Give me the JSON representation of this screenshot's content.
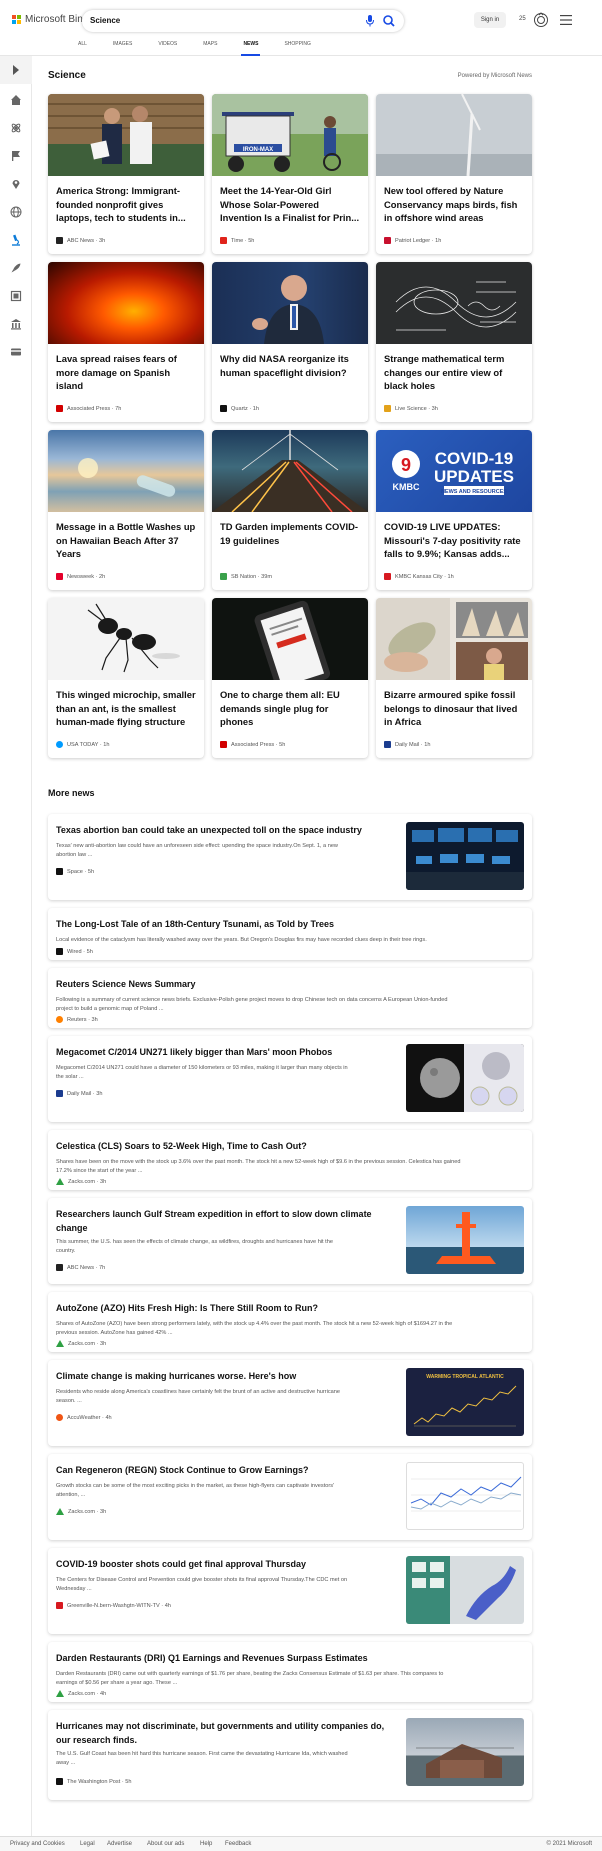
{
  "header": {
    "logo_text": "Microsoft Bing",
    "query": "Science",
    "sign_in": "Sign in",
    "points": "25"
  },
  "tabs": [
    "ALL",
    "IMAGES",
    "VIDEOS",
    "MAPS",
    "NEWS",
    "SHOPPING"
  ],
  "section": {
    "title": "Science",
    "powered": "Powered by Microsoft News"
  },
  "cards": [
    {
      "title": "America Strong: Immigrant-founded nonprofit gives laptops, tech to students in...",
      "source": "ABC News · 3h",
      "icon_color": "#222"
    },
    {
      "title": "Meet the 14-Year-Old Girl Whose Solar-Powered Invention Is a Finalist for Prin...",
      "source": "Time · 5h",
      "icon_color": "#e0241b"
    },
    {
      "title": "New tool offered by Nature Conservancy maps birds, fish in offshore wind areas",
      "source": "Patriot Ledger · 1h",
      "icon_color": "#c8102e"
    },
    {
      "title": "Lava spread raises fears of more damage on Spanish island",
      "source": "Associated Press · 7h",
      "icon_color": "#d20000"
    },
    {
      "title": "Why did NASA reorganize its human spaceflight division?",
      "source": "Quartz · 1h",
      "icon_color": "#111"
    },
    {
      "title": "Strange mathematical term changes our entire view of black holes",
      "source": "Live Science · 3h",
      "icon_color": "#e3a21a"
    },
    {
      "title": "Message in a Bottle Washes up on Hawaiian Beach After 37 Years",
      "source": "Newsweek · 2h",
      "icon_color": "#e4002b"
    },
    {
      "title": "TD Garden implements COVID-19 guidelines",
      "source": "SB Nation · 39m",
      "icon_color": "#3aa14b"
    },
    {
      "title": "COVID-19 LIVE UPDATES: Missouri's 7-day positivity rate falls to 9.9%; Kansas adds...",
      "source": "KMBC Kansas City · 1h",
      "icon_color": "#d71920"
    },
    {
      "title": "This winged microchip, smaller than an ant, is the smallest human-made flying structure",
      "source": "USA TODAY · 1h",
      "icon_color": "#009bff"
    },
    {
      "title": "One to charge them all: EU demands single plug for phones",
      "source": "Associated Press · 5h",
      "icon_color": "#d20000"
    },
    {
      "title": "Bizarre armoured spike fossil belongs to dinosaur that lived in Africa",
      "source": "Daily Mail · 1h",
      "icon_color": "#1b3c8f"
    }
  ],
  "covid_art": {
    "big": "COVID-19",
    "sub": "UPDATES",
    "small": "NEWS AND RESOURCES",
    "station": "KMBC",
    "ch": "9"
  },
  "iron_sign": "IRON-MAX",
  "hurricane_art": "WARMING TROPICAL ATLANTIC",
  "more_news_title": "More news",
  "more_news": [
    {
      "title": "Texas abortion ban could take an unexpected toll on the space industry",
      "desc": [
        "Texas' new anti-abortion law could have an unforeseen side effect: upending the space industry.On Sept. 1, a new",
        "abortion law ..."
      ],
      "source": "Space · 5h",
      "icon_color": "#111"
    },
    {
      "title": "The Long-Lost Tale of an 18th-Century Tsunami, as Told by Trees",
      "desc": [
        "Local evidence of the cataclysm has literally washed away over the years. But Oregon's Douglas firs may have recorded clues deep in their tree rings."
      ],
      "source": "Wired · 5h",
      "icon_color": "#111"
    },
    {
      "title": "Reuters Science News Summary",
      "desc": [
        "Following is a summary of current science news briefs. Exclusive-Polish gene project moves to drop Chinese tech on data concerns A European Union-funded",
        "project to build a genomic map of Poland ..."
      ],
      "source": "Reuters · 3h",
      "icon_color": "#ff8000"
    },
    {
      "title": "Megacomet C/2014 UN271 likely bigger than Mars' moon Phobos",
      "desc": [
        "Megacomet C/2014 UN271 could have a diameter of 150 kilometers or 93 miles, making it larger than many objects in",
        "the solar ..."
      ],
      "source": "Daily Mail · 3h",
      "icon_color": "#1b3c8f"
    },
    {
      "title": "Celestica (CLS) Soars to 52-Week High, Time to Cash Out?",
      "desc": [
        "Shares have been on the move with the stock up 3.6% over the past month. The stock hit a new 52-week high of $9.6 in the previous session. Celestica has gained",
        "17.2% since the start of the year ..."
      ],
      "source": "Zacks.com · 3h",
      "icon_color": "#2ea043"
    },
    {
      "title": "Researchers launch Gulf Stream expedition in effort to slow down climate change",
      "desc": [
        "This summer, the U.S. has seen the effects of climate change, as wildfires, droughts and hurricanes have hit the",
        "country."
      ],
      "source": "ABC News · 7h",
      "icon_color": "#222"
    },
    {
      "title": "AutoZone (AZO) Hits Fresh High: Is There Still Room to Run?",
      "desc": [
        "Shares of AutoZone (AZO) have been strong performers lately, with the stock up 4.4% over the past month. The stock hit a new 52-week high of $1694.27 in the",
        "previous session. AutoZone has gained 42% ..."
      ],
      "source": "Zacks.com · 3h",
      "icon_color": "#2ea043"
    },
    {
      "title": "Climate change is making hurricanes worse. Here's how",
      "desc": [
        "Residents who reside along America's coastlines have certainly felt the brunt of an active and destructive hurricane",
        "season. ..."
      ],
      "source": "AccuWeather · 4h",
      "icon_color": "#f05514"
    },
    {
      "title": "Can Regeneron (REGN) Stock Continue to Grow Earnings?",
      "desc": [
        "Growth stocks can be some of the most exciting picks in the market, as these high-flyers can captivate investors'",
        "attention, ..."
      ],
      "source": "Zacks.com · 3h",
      "icon_color": "#2ea043"
    },
    {
      "title": "COVID-19 booster shots could get final approval Thursday",
      "desc": [
        "The Centers for Disease Control and Prevention could give booster shots its final approval Thursday.The CDC met on",
        "Wednesday ..."
      ],
      "source": "Greenville-N.bern-Washgtn-WITN-TV · 4h",
      "icon_color": "#d71920"
    },
    {
      "title": "Darden Restaurants (DRI) Q1 Earnings and Revenues Surpass Estimates",
      "desc": [
        "Darden Restaurants (DRI) came out with quarterly earnings of $1.76 per share, beating the Zacks Consensus Estimate of $1.63 per share. This compares to",
        "earnings of $0.56 per share a year ago. These ..."
      ],
      "source": "Zacks.com · 4h",
      "icon_color": "#2ea043"
    },
    {
      "title": "Hurricanes may not discriminate, but governments and utility companies do, our research finds.",
      "desc": [
        "The U.S. Gulf Coast has been hit hard this hurricane season. First came the devastating Hurricane Ida, which washed",
        "away ..."
      ],
      "source": "The Washington Post · 5h",
      "icon_color": "#111"
    }
  ],
  "footer": {
    "links": [
      "Privacy and Cookies",
      "Legal",
      "Advertise",
      "About our ads",
      "Help",
      "Feedback"
    ],
    "copyright": "© 2021 Microsoft"
  },
  "icons": [
    "microsoft-logo",
    "microphone-icon",
    "search-icon",
    "rewards-icon",
    "hamburger-menu-icon",
    "expand-sidebar-icon",
    "home-icon",
    "science-icon",
    "flag-icon",
    "location-icon",
    "globe-icon",
    "microscope-icon",
    "rocket-icon",
    "newspaper-icon",
    "building-icon",
    "card-icon"
  ]
}
